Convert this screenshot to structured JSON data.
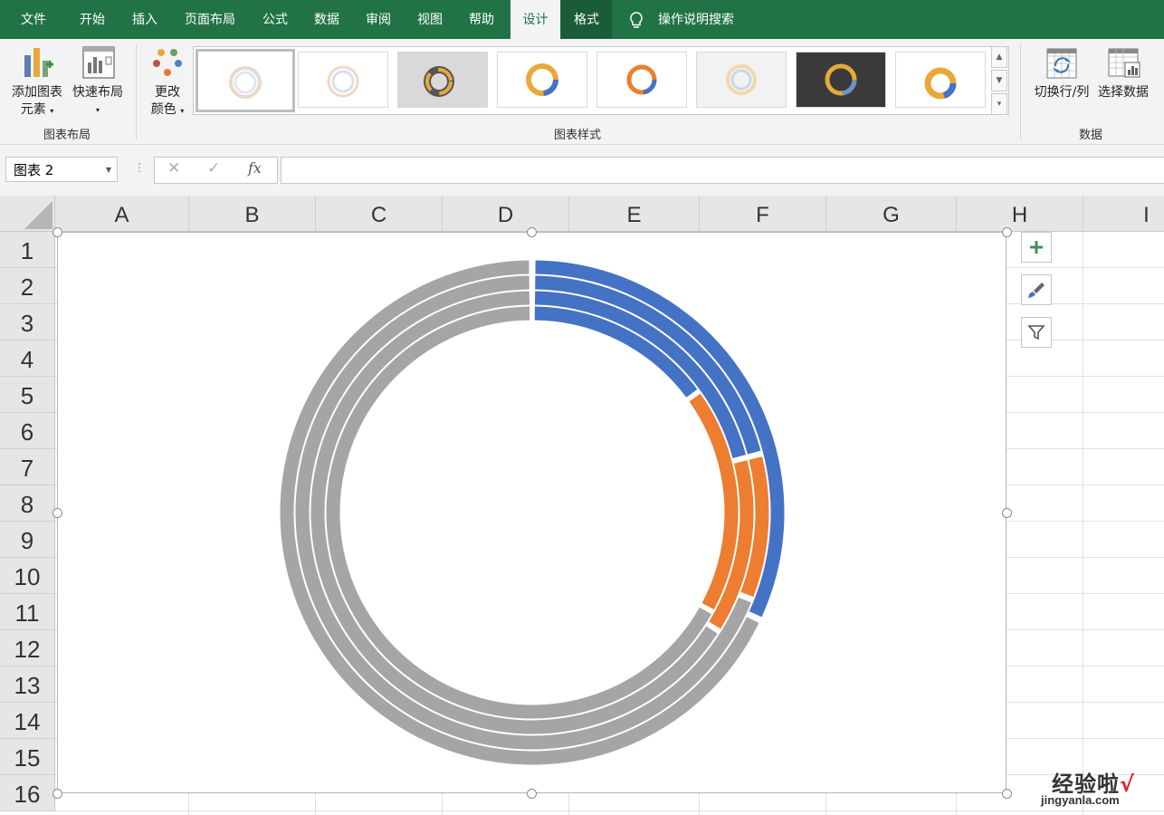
{
  "ribbon_tabs": [
    "文件",
    "开始",
    "插入",
    "页面布局",
    "公式",
    "数据",
    "审阅",
    "视图",
    "帮助",
    "设计",
    "格式"
  ],
  "active_tab": "设计",
  "search_tab": "操作说明搜索",
  "layout_group": {
    "add_element_label": "添加图表",
    "add_element_label2": "元素",
    "quick_layout_label": "快速布局",
    "group_label": "图表布局"
  },
  "styles_group": {
    "change_colors_label": "更改",
    "change_colors_label2": "颜色",
    "group_label": "图表样式"
  },
  "data_group": {
    "switch_label": "切换行/列",
    "select_label": "选择数据",
    "group_label": "数据"
  },
  "formula_bar": {
    "name_box": "图表 2",
    "cancel_symbol": "✕",
    "enter_symbol": "✓",
    "fx_label": "fx",
    "formula": ""
  },
  "columns": [
    "A",
    "B",
    "C",
    "D",
    "E",
    "F",
    "G",
    "H",
    "I"
  ],
  "rows": [
    "1",
    "2",
    "3",
    "4",
    "5",
    "6",
    "7",
    "8",
    "9",
    "10",
    "11",
    "12",
    "13",
    "14",
    "15",
    "16"
  ],
  "colors": {
    "excel_green": "#217346",
    "series_blue": "#4472C4",
    "series_orange": "#ED7D31",
    "series_gray": "#A5A5A5"
  },
  "chart_data": {
    "type": "doughnut",
    "rings": [
      {
        "values": [
          0.32,
          0,
          0.68
        ]
      },
      {
        "values": [
          0.21,
          0.1,
          0.69
        ]
      },
      {
        "values": [
          0.21,
          0.13,
          0.66
        ]
      },
      {
        "values": [
          0.15,
          0.18,
          0.67
        ]
      }
    ],
    "series_colors": [
      "#4472C4",
      "#ED7D31",
      "#A5A5A5"
    ]
  },
  "side_buttons": [
    "plus-icon",
    "brush-icon",
    "filter-icon"
  ],
  "watermark": {
    "line1": "经验啦",
    "check": "√",
    "line2": "jingyanla.com"
  }
}
